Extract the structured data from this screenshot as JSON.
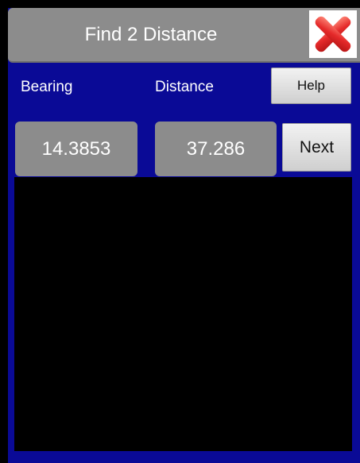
{
  "title_bar": {
    "title": "Find 2 Distance",
    "close_icon": "close-x-icon",
    "close_colors": {
      "primary": "#e02222",
      "highlight": "#ff7a6a"
    }
  },
  "labels": {
    "bearing": "Bearing",
    "distance": "Distance"
  },
  "buttons": {
    "help": "Help",
    "next": "Next"
  },
  "values": {
    "bearing": "14.3853",
    "distance": "37.286"
  },
  "colors": {
    "panel_background": "#0a0a96",
    "field_background": "#8c8c8c",
    "canvas_background": "#000000"
  }
}
